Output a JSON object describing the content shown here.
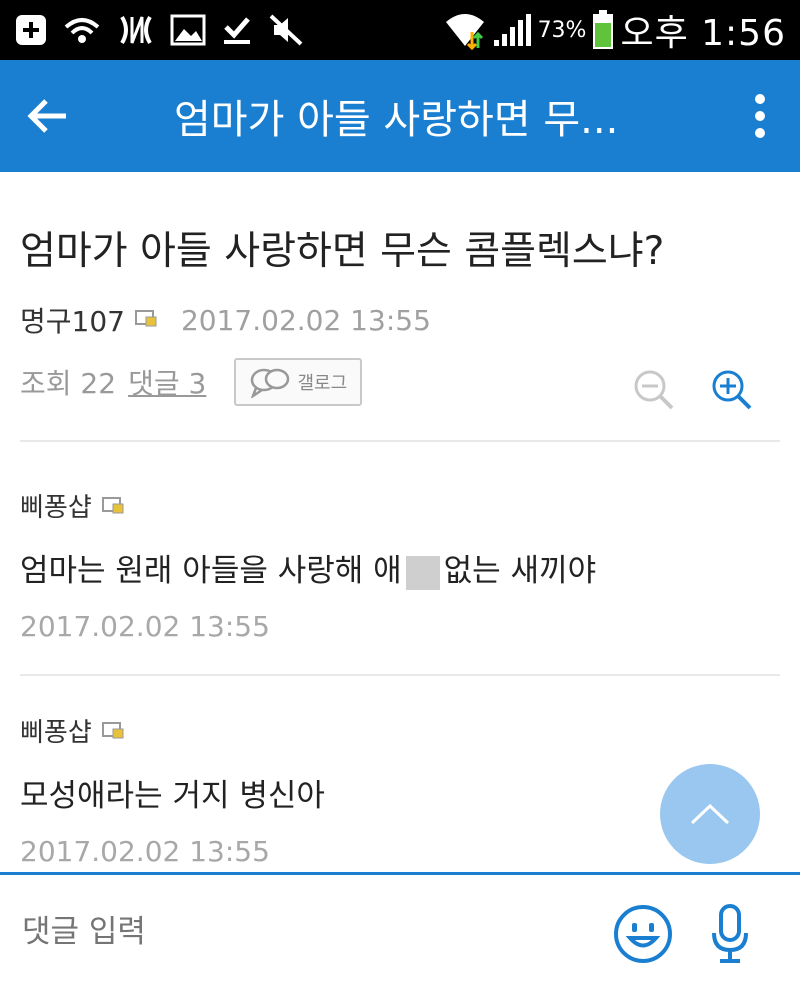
{
  "status_bar": {
    "battery_text": "73%",
    "time": "오후 1:56",
    "icons": [
      "add-icon",
      "wifi-hotspot-icon",
      "nfc-icon",
      "image-icon",
      "download-done-icon",
      "mute-icon",
      "wifi-icon",
      "signal-icon",
      "battery-icon"
    ]
  },
  "app_bar": {
    "title": "엄마가 아들 사랑하면 무...",
    "color": "#1a7fd1"
  },
  "post": {
    "title": "엄마가 아들 사랑하면 무슨 콤플렉스냐?",
    "author": "명구107",
    "date": "2017.02.02 13:55",
    "views_label": "조회 22",
    "comments_label": "댓글 3",
    "gallog_label": "갤로그"
  },
  "comments": [
    {
      "author": "삐퐁샵",
      "text_before": "엄마는 원래 아들을 사랑해 애",
      "text_after": "없는 새끼야",
      "date": "2017.02.02 13:55"
    },
    {
      "author": "삐퐁샵",
      "text": "모성애라는 거지 병신아",
      "date": "2017.02.02 13:55"
    }
  ],
  "comment_input": {
    "placeholder": "댓글 입력"
  }
}
